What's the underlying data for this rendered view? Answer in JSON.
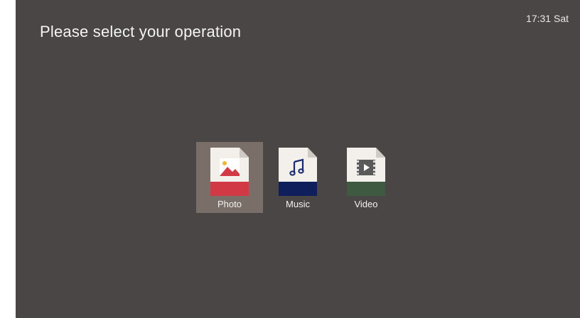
{
  "header": {
    "title": "Please select your operation",
    "clock": "17:31 Sat"
  },
  "apps": [
    {
      "label": "Photo",
      "icon": "photo-file-icon",
      "color": "#d13a44",
      "selected": true
    },
    {
      "label": "Music",
      "icon": "music-file-icon",
      "color": "#0f1f5c",
      "selected": false
    },
    {
      "label": "Video",
      "icon": "video-file-icon",
      "color": "#3e5a40",
      "selected": false
    }
  ],
  "colors": {
    "background": "#4a4646",
    "selection": "#7a6e69"
  }
}
